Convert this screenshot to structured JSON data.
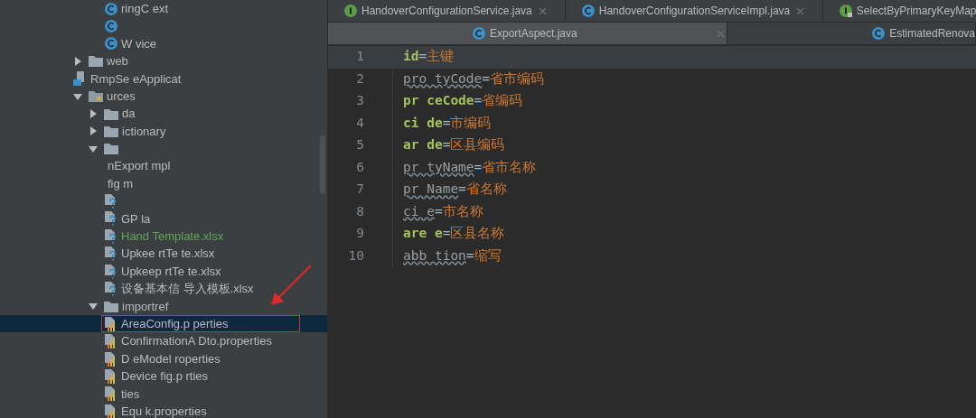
{
  "project_tree": {
    "leading_items": [
      {
        "kind": "class",
        "label": "ringC ext"
      },
      {
        "kind": "class"
      },
      {
        "kind": "class",
        "label": "W vice"
      }
    ],
    "nodes": [
      {
        "kind": "folder",
        "label": "web",
        "expanded": false
      },
      {
        "kind": "app",
        "label": "RmpSe eApplicat"
      },
      {
        "kind": "resource-folder",
        "label": "urces",
        "expanded": true,
        "children": [
          {
            "kind": "folder",
            "label": "da",
            "expanded": false
          },
          {
            "kind": "folder",
            "label": "ictionary",
            "expanded": false
          },
          {
            "kind": "folder",
            "expanded": true,
            "children": [
              {
                "kind": "blank",
                "label": "nExport mpl"
              },
              {
                "kind": "blank",
                "label": "fig m"
              },
              {
                "kind": "unknown"
              },
              {
                "kind": "unknown",
                "label": "GP la",
                "added": false
              },
              {
                "kind": "unknown",
                "label": "Hand Template.xlsx",
                "added": true
              },
              {
                "kind": "unknown",
                "label": "Upkee rtTe te.xlsx",
                "added": false
              },
              {
                "kind": "unknown",
                "label": "Upkeep rtTe te.xlsx",
                "added": false
              },
              {
                "kind": "unknown",
                "label": "设备基本信 导入模板.xlsx",
                "added": false
              }
            ]
          },
          {
            "kind": "folder",
            "label": "importref",
            "expanded": true,
            "children": [
              {
                "kind": "properties",
                "label": "AreaConfig.p perties",
                "selected": true
              },
              {
                "kind": "properties",
                "label": "ConfirmationA Dto.properties",
                "selected": false
              },
              {
                "kind": "properties",
                "label": "D eModel roperties",
                "selected": false
              },
              {
                "kind": "properties",
                "label": "Device fig.p rties",
                "selected": false
              },
              {
                "kind": "properties",
                "label": "ties",
                "selected": false
              },
              {
                "kind": "properties",
                "label": "Equ k.properties",
                "selected": false
              }
            ]
          }
        ]
      }
    ]
  },
  "tab_rows": [
    [
      {
        "kind": "interface",
        "label": "HandoverConfigurationService.java",
        "selected": false,
        "closable": true
      },
      {
        "kind": "class",
        "label": "HandoverConfigurationServiceImpl.java",
        "selected": false,
        "closable": true
      },
      {
        "kind": "locked-interface",
        "label": "SelectByPrimaryKeyMap",
        "selected": false,
        "closable": false
      }
    ],
    [
      {
        "kind": "class",
        "label": "ExportAspect.java",
        "selected": true,
        "closable": true
      },
      {
        "kind": "class",
        "label": "EstimatedRenova",
        "selected": false,
        "closable": false
      }
    ]
  ],
  "editor": {
    "lines": [
      {
        "number": "1",
        "key": "id",
        "value": "主键",
        "used": true,
        "current": true
      },
      {
        "number": "2",
        "key": "pro tyCode",
        "value": "省市编码",
        "used": false,
        "current": false
      },
      {
        "number": "3",
        "key": "pr ceCode",
        "value": "省编码",
        "used": true,
        "current": false
      },
      {
        "number": "4",
        "key": "ci de",
        "value": "市编码",
        "used": true,
        "current": false
      },
      {
        "number": "5",
        "key": "ar de",
        "value": "区县编码",
        "used": true,
        "current": false
      },
      {
        "number": "6",
        "key": "pr tyName",
        "value": "省市名称",
        "used": false,
        "current": false
      },
      {
        "number": "7",
        "key": "pr Name",
        "value": "省名称",
        "used": false,
        "current": false
      },
      {
        "number": "8",
        "key": "ci e",
        "value": "市名称",
        "used": false,
        "current": false
      },
      {
        "number": "9",
        "key": "are e",
        "value": "区县名称",
        "used": true,
        "current": false
      },
      {
        "number": "10",
        "key": "abb tion",
        "value": "缩写",
        "used": false,
        "current": false
      }
    ],
    "separator": "="
  }
}
